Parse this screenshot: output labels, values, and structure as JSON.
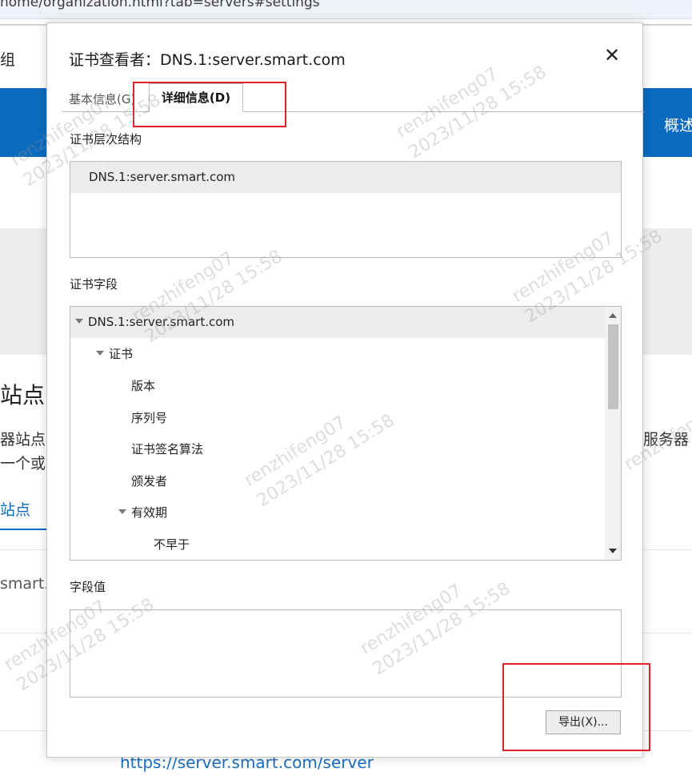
{
  "browser": {
    "url_fragment": "home/organization.html?tab=servers#settings"
  },
  "background": {
    "left_label_zu": "组",
    "right_label": "概述",
    "section_title": "站点",
    "line1": "器站点",
    "line2": "一个或",
    "right_line": "服务器",
    "tab_label": "站点",
    "row_text": "smart.",
    "bottom_link": "https://server.smart.com/server"
  },
  "dialog": {
    "title": "证书查看者：DNS.1:server.smart.com",
    "close_glyph": "✕",
    "tabs": [
      {
        "label": "基本信息(G)",
        "active": false
      },
      {
        "label": "详细信息(D)",
        "active": true
      }
    ],
    "hierarchy_label": "证书层次结构",
    "hierarchy_items": [
      "DNS.1:server.smart.com"
    ],
    "fields_label": "证书字段",
    "fields": [
      {
        "label": "DNS.1:server.smart.com",
        "expanded": true,
        "selected": true
      },
      {
        "label": "证书",
        "expanded": true
      },
      {
        "label": "版本"
      },
      {
        "label": "序列号"
      },
      {
        "label": "证书签名算法"
      },
      {
        "label": "颁发者"
      },
      {
        "label": "有效期",
        "expanded": true
      },
      {
        "label": "不早于"
      }
    ],
    "value_label": "字段值",
    "value_text": "",
    "export_button": "导出(X)..."
  },
  "watermark": {
    "user": "renzhifeng07",
    "time": "2023/11/28 15:58"
  },
  "colors": {
    "accent_blue": "#0b6bbf",
    "annotation_red": "#e0242a"
  }
}
